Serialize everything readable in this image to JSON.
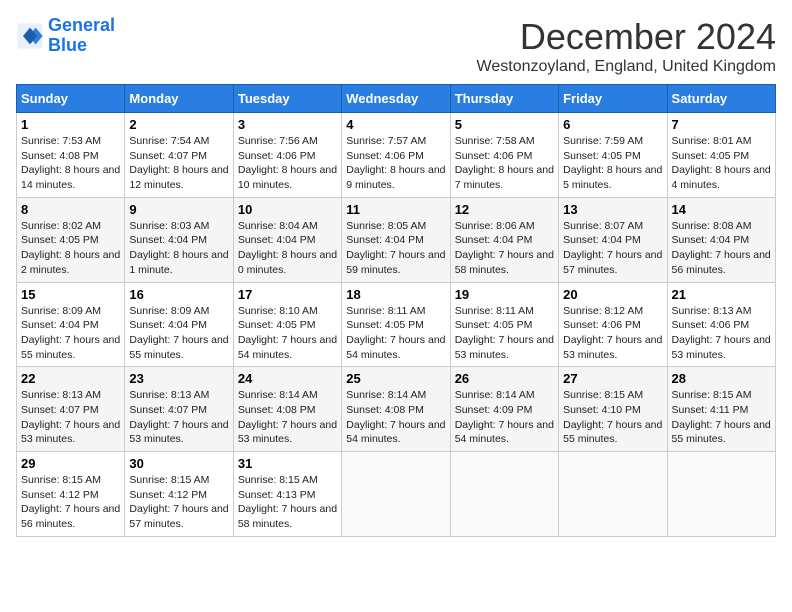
{
  "logo": {
    "line1": "General",
    "line2": "Blue"
  },
  "title": "December 2024",
  "subtitle": "Westonzoyland, England, United Kingdom",
  "weekdays": [
    "Sunday",
    "Monday",
    "Tuesday",
    "Wednesday",
    "Thursday",
    "Friday",
    "Saturday"
  ],
  "weeks": [
    [
      {
        "day": "1",
        "sunrise": "7:53 AM",
        "sunset": "4:08 PM",
        "daylight": "8 hours and 14 minutes."
      },
      {
        "day": "2",
        "sunrise": "7:54 AM",
        "sunset": "4:07 PM",
        "daylight": "8 hours and 12 minutes."
      },
      {
        "day": "3",
        "sunrise": "7:56 AM",
        "sunset": "4:06 PM",
        "daylight": "8 hours and 10 minutes."
      },
      {
        "day": "4",
        "sunrise": "7:57 AM",
        "sunset": "4:06 PM",
        "daylight": "8 hours and 9 minutes."
      },
      {
        "day": "5",
        "sunrise": "7:58 AM",
        "sunset": "4:06 PM",
        "daylight": "8 hours and 7 minutes."
      },
      {
        "day": "6",
        "sunrise": "7:59 AM",
        "sunset": "4:05 PM",
        "daylight": "8 hours and 5 minutes."
      },
      {
        "day": "7",
        "sunrise": "8:01 AM",
        "sunset": "4:05 PM",
        "daylight": "8 hours and 4 minutes."
      }
    ],
    [
      {
        "day": "8",
        "sunrise": "8:02 AM",
        "sunset": "4:05 PM",
        "daylight": "8 hours and 2 minutes."
      },
      {
        "day": "9",
        "sunrise": "8:03 AM",
        "sunset": "4:04 PM",
        "daylight": "8 hours and 1 minute."
      },
      {
        "day": "10",
        "sunrise": "8:04 AM",
        "sunset": "4:04 PM",
        "daylight": "8 hours and 0 minutes."
      },
      {
        "day": "11",
        "sunrise": "8:05 AM",
        "sunset": "4:04 PM",
        "daylight": "7 hours and 59 minutes."
      },
      {
        "day": "12",
        "sunrise": "8:06 AM",
        "sunset": "4:04 PM",
        "daylight": "7 hours and 58 minutes."
      },
      {
        "day": "13",
        "sunrise": "8:07 AM",
        "sunset": "4:04 PM",
        "daylight": "7 hours and 57 minutes."
      },
      {
        "day": "14",
        "sunrise": "8:08 AM",
        "sunset": "4:04 PM",
        "daylight": "7 hours and 56 minutes."
      }
    ],
    [
      {
        "day": "15",
        "sunrise": "8:09 AM",
        "sunset": "4:04 PM",
        "daylight": "7 hours and 55 minutes."
      },
      {
        "day": "16",
        "sunrise": "8:09 AM",
        "sunset": "4:04 PM",
        "daylight": "7 hours and 55 minutes."
      },
      {
        "day": "17",
        "sunrise": "8:10 AM",
        "sunset": "4:05 PM",
        "daylight": "7 hours and 54 minutes."
      },
      {
        "day": "18",
        "sunrise": "8:11 AM",
        "sunset": "4:05 PM",
        "daylight": "7 hours and 54 minutes."
      },
      {
        "day": "19",
        "sunrise": "8:11 AM",
        "sunset": "4:05 PM",
        "daylight": "7 hours and 53 minutes."
      },
      {
        "day": "20",
        "sunrise": "8:12 AM",
        "sunset": "4:06 PM",
        "daylight": "7 hours and 53 minutes."
      },
      {
        "day": "21",
        "sunrise": "8:13 AM",
        "sunset": "4:06 PM",
        "daylight": "7 hours and 53 minutes."
      }
    ],
    [
      {
        "day": "22",
        "sunrise": "8:13 AM",
        "sunset": "4:07 PM",
        "daylight": "7 hours and 53 minutes."
      },
      {
        "day": "23",
        "sunrise": "8:13 AM",
        "sunset": "4:07 PM",
        "daylight": "7 hours and 53 minutes."
      },
      {
        "day": "24",
        "sunrise": "8:14 AM",
        "sunset": "4:08 PM",
        "daylight": "7 hours and 53 minutes."
      },
      {
        "day": "25",
        "sunrise": "8:14 AM",
        "sunset": "4:08 PM",
        "daylight": "7 hours and 54 minutes."
      },
      {
        "day": "26",
        "sunrise": "8:14 AM",
        "sunset": "4:09 PM",
        "daylight": "7 hours and 54 minutes."
      },
      {
        "day": "27",
        "sunrise": "8:15 AM",
        "sunset": "4:10 PM",
        "daylight": "7 hours and 55 minutes."
      },
      {
        "day": "28",
        "sunrise": "8:15 AM",
        "sunset": "4:11 PM",
        "daylight": "7 hours and 55 minutes."
      }
    ],
    [
      {
        "day": "29",
        "sunrise": "8:15 AM",
        "sunset": "4:12 PM",
        "daylight": "7 hours and 56 minutes."
      },
      {
        "day": "30",
        "sunrise": "8:15 AM",
        "sunset": "4:12 PM",
        "daylight": "7 hours and 57 minutes."
      },
      {
        "day": "31",
        "sunrise": "8:15 AM",
        "sunset": "4:13 PM",
        "daylight": "7 hours and 58 minutes."
      },
      null,
      null,
      null,
      null
    ]
  ]
}
